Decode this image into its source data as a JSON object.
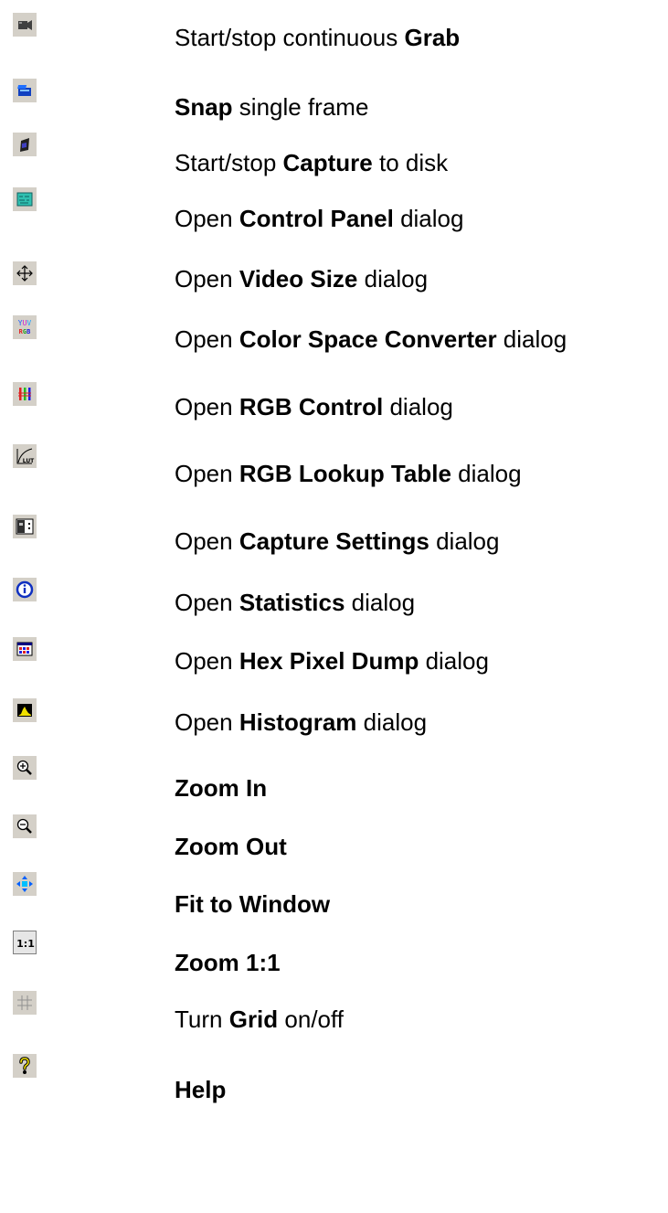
{
  "items": [
    {
      "icon": "video-camera-icon",
      "pre": "Start/stop continuous ",
      "bold": "Grab",
      "post": ""
    },
    {
      "icon": "snap-camera-icon",
      "pre": "",
      "bold": "Snap",
      "post": " single frame"
    },
    {
      "icon": "capture-disk-icon",
      "pre": "Start/stop ",
      "bold": "Capture",
      "post": " to disk"
    },
    {
      "icon": "control-panel-icon",
      "pre": "Open ",
      "bold": "Control Panel",
      "post": " dialog"
    },
    {
      "icon": "move-arrows-icon",
      "pre": "Open ",
      "bold": "Video Size",
      "post": " dialog"
    },
    {
      "icon": "yuv-rgb-icon",
      "pre": "Open ",
      "bold": "Color Space Converter",
      "post": " dialog",
      "icon_text_top": "YUV",
      "icon_text_bottom": "RGB"
    },
    {
      "icon": "rgb-bars-icon",
      "pre": "Open ",
      "bold": "RGB Control",
      "post": " dialog"
    },
    {
      "icon": "lut-curve-icon",
      "pre": "Open ",
      "bold": "RGB Lookup Table",
      "post": " dialog",
      "icon_text": "LUT"
    },
    {
      "icon": "capture-settings-icon",
      "pre": "Open ",
      "bold": "Capture Settings",
      "post": " dialog"
    },
    {
      "icon": "info-icon",
      "pre": "Open ",
      "bold": "Statistics",
      "post": " dialog"
    },
    {
      "icon": "hex-dump-icon",
      "pre": "Open ",
      "bold": "Hex Pixel Dump",
      "post": " dialog"
    },
    {
      "icon": "histogram-icon",
      "pre": "Open ",
      "bold": "Histogram",
      "post": " dialog"
    },
    {
      "icon": "zoom-in-icon",
      "pre": "",
      "bold": "Zoom In",
      "post": ""
    },
    {
      "icon": "zoom-out-icon",
      "pre": "",
      "bold": "Zoom Out",
      "post": ""
    },
    {
      "icon": "fit-window-icon",
      "pre": "",
      "bold": "Fit to Window",
      "post": ""
    },
    {
      "icon": "zoom-one-to-one-icon",
      "pre": "",
      "bold": "Zoom 1:1",
      "post": "",
      "icon_text": "1:1"
    },
    {
      "icon": "grid-icon",
      "pre": "Turn ",
      "bold": "Grid",
      "post": " on/off"
    },
    {
      "icon": "help-icon",
      "pre": "",
      "bold": "Help",
      "post": ""
    }
  ]
}
